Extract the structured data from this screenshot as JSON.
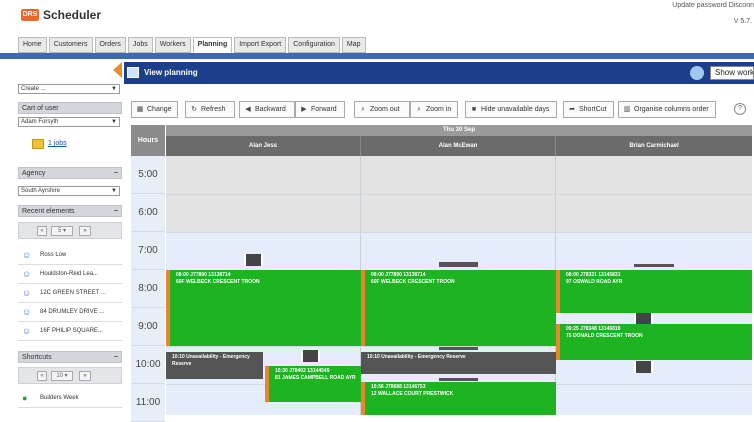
{
  "app": {
    "title": "Scheduler",
    "logo_text": "DRS",
    "top_links": "Update password  Disconn",
    "version": "V 5.7.",
    "accent": "#e8672a"
  },
  "nav": {
    "tabs": [
      {
        "label": "Home"
      },
      {
        "label": "Customers"
      },
      {
        "label": "Orders"
      },
      {
        "label": "Jobs"
      },
      {
        "label": "Workers"
      },
      {
        "label": "Planning",
        "active": true
      },
      {
        "label": "Import Export"
      },
      {
        "label": "Configuration"
      },
      {
        "label": "Map"
      }
    ]
  },
  "sidebar": {
    "create_select": "Create ...",
    "cart_label": "Cart of user",
    "user_select": "Adam Forsyth",
    "jobs_link": "1 jobs",
    "agency_label": "Agency",
    "agency_select": "South Ayrshire",
    "recent_label": "Recent elements",
    "recent_pager_value": "5",
    "recent_items": [
      "Ross Low",
      "Houldston-Reid Lea...",
      "12C GREEN STREET ...",
      "84 DRUMLEY DRIVE ...",
      "16F PHILIP SQUARE..."
    ],
    "shortcuts_label": "Shortcuts",
    "shortcuts_pager_value": "10",
    "shortcut_items": [
      "Builders Week"
    ]
  },
  "view": {
    "title": "View planning",
    "show_workers": "Show worke"
  },
  "toolbar": {
    "change": "Change",
    "refresh": "Refresh",
    "backward": "Backward",
    "forward": "Forward",
    "zoom_out": "Zoom out",
    "zoom_in": "Zoom in",
    "hide_unavailable": "Hide unavailable days",
    "shortcut": "ShortCut",
    "organise": "Organise columns order",
    "help": "?"
  },
  "planning": {
    "hours_label": "Hours",
    "date": "Thu 30 Sep",
    "hours": [
      "5:00",
      "6:00",
      "7:00",
      "8:00",
      "9:00",
      "10:00",
      "11:00"
    ],
    "workers": [
      "Alan Jess",
      "Alan McEwan",
      "Brian Carmichael"
    ],
    "events": [
      {
        "line1": "08:00 J77890 13138714",
        "line2": "60F WELBECK CRESCENT TROON"
      },
      {
        "line1": "08:00 J77890 13138714",
        "line2": "60F WELBECK CRESCENT TROON"
      },
      {
        "line1": "08:00 J78331 13145831",
        "line2": "97 OSWALD ROAD AYR"
      },
      {
        "line1": "09:25 J78348 13146818",
        "line2": "75 DONALD CRESCENT TROON"
      },
      {
        "line1": "10:10 Unavailability - Emergency",
        "line2": "Reserve"
      },
      {
        "line1": "10:30 J78402 13144549",
        "line2": "81 JAMES CAMPBELL ROAD AYR"
      },
      {
        "line1": "10:10 Unavailability - Emergency Reserve",
        "line2": ""
      },
      {
        "line1": "10:56 J78688 13146753",
        "line2": "12 WALLACE COURT PRESTWICK"
      }
    ]
  }
}
